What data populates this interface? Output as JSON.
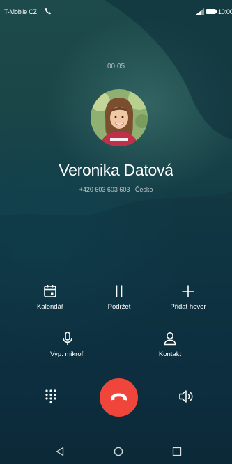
{
  "status_bar": {
    "carrier": "T-Mobile CZ",
    "time": "10:00",
    "icons": [
      "phone-call-icon",
      "signal-icon",
      "battery-icon"
    ]
  },
  "call": {
    "duration": "00:05",
    "name": "Veronika Datová",
    "number_and_location": "+420 603 603 603   Česko"
  },
  "actions": [
    {
      "label": "Kalendář",
      "icon": "calendar-icon"
    },
    {
      "label": "Podržet",
      "icon": "pause-icon"
    },
    {
      "label": "Přidat hovor",
      "icon": "plus-icon"
    },
    {
      "label": "Vyp. mikrof.",
      "icon": "microphone-icon"
    },
    {
      "label": "Kontakt",
      "icon": "person-icon"
    }
  ],
  "bottom_controls": {
    "icons": [
      "dialpad-icon",
      "end-call-icon",
      "speaker-icon"
    ],
    "end_call_color": "#f0453a"
  },
  "nav_bar": {
    "icons": [
      "back-icon",
      "home-icon",
      "recent-apps-icon"
    ]
  }
}
